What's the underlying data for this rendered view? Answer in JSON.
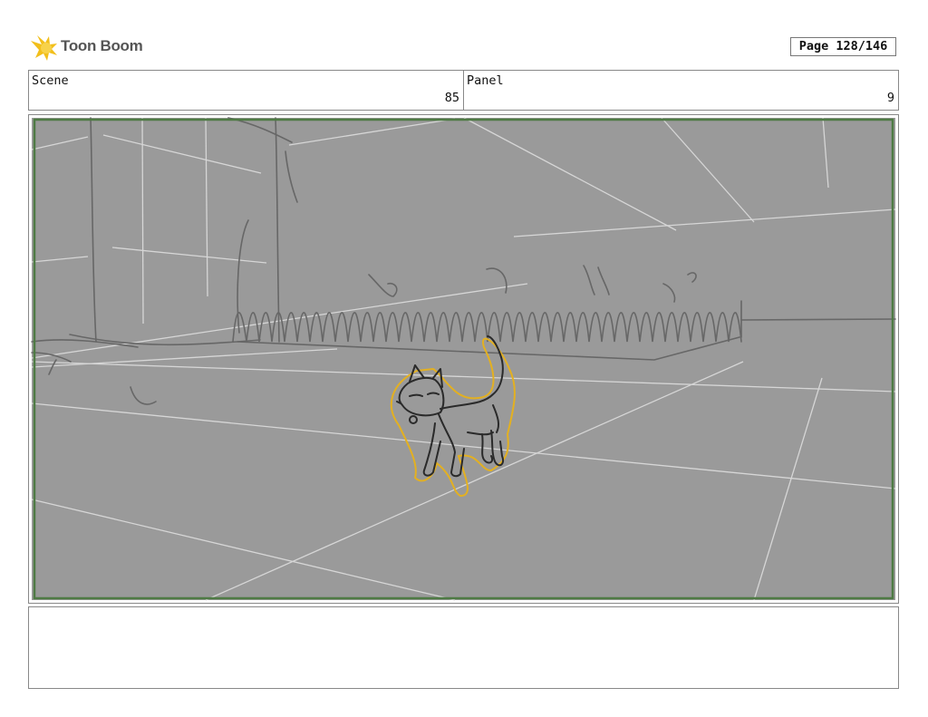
{
  "header": {
    "logo_text": "Toon Boom",
    "page_label": "Page 128/146"
  },
  "scene": {
    "label": "Scene",
    "value": "85"
  },
  "panel": {
    "label": "Panel",
    "value": "9"
  },
  "colors": {
    "sketch_background": "#9a9a9a",
    "safe_frame": "#4e7a44",
    "cat_highlight": "#e3b021",
    "logo_accent": "#f2bf1b"
  },
  "notes": {
    "text": ""
  }
}
